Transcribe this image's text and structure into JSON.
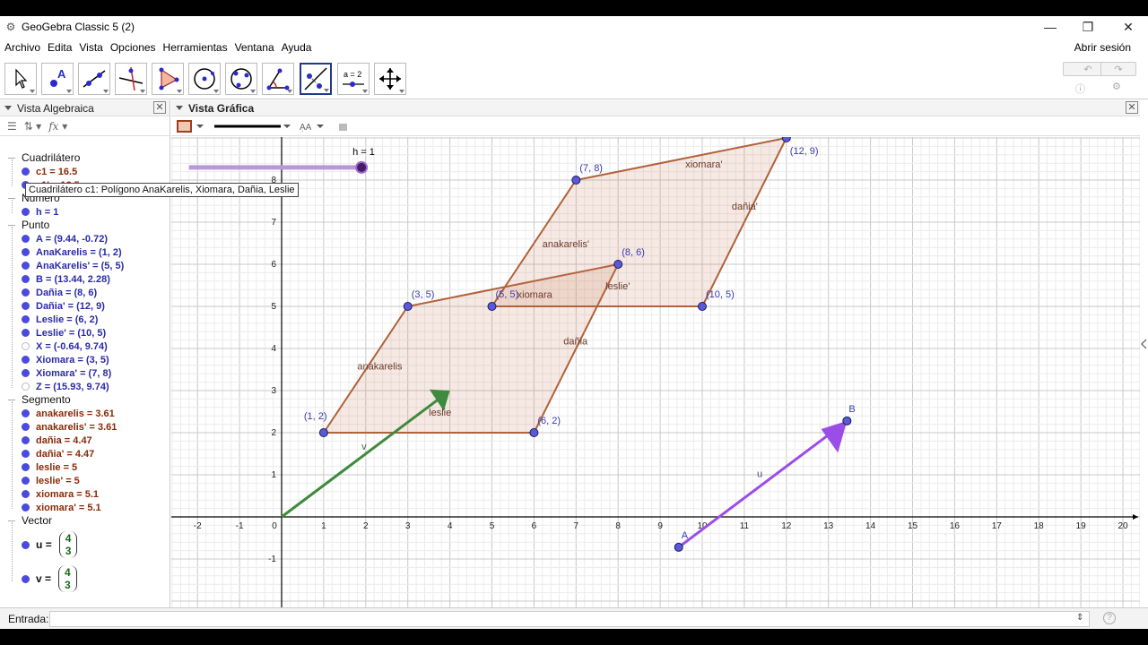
{
  "window": {
    "title": "GeoGebra Classic 5 (2)",
    "minimize": "—",
    "maximize": "❐",
    "close": "✕"
  },
  "menu": {
    "items": [
      "Archivo",
      "Edita",
      "Vista",
      "Opciones",
      "Herramientas",
      "Ventana",
      "Ayuda"
    ],
    "signin": "Abrir sesión"
  },
  "toolbar": {
    "tools": [
      "move",
      "point",
      "line",
      "perpendicular",
      "polygon",
      "circle",
      "conic",
      "angle",
      "reflect",
      "slider",
      "move-graphics"
    ],
    "selected": "reflect",
    "slider_label": "a = 2"
  },
  "algebra": {
    "title": "Vista Algebraica",
    "groups": {
      "quad": "Cuadrilátero",
      "number": "Número",
      "point": "Punto",
      "segment": "Segmento",
      "vector": "Vector"
    },
    "quad_items": [
      "c1 = 16.5",
      "c1' = 16.5"
    ],
    "number_items": [
      "h = 1"
    ],
    "point_items": [
      {
        "text": "A = (9.44, -0.72)",
        "on": true
      },
      {
        "text": "AnaKarelis = (1, 2)",
        "on": true
      },
      {
        "text": "AnaKarelis' = (5, 5)",
        "on": true
      },
      {
        "text": "B = (13.44, 2.28)",
        "on": true
      },
      {
        "text": "Dañia = (8, 6)",
        "on": true
      },
      {
        "text": "Dañia' = (12, 9)",
        "on": true
      },
      {
        "text": "Leslie = (6, 2)",
        "on": true
      },
      {
        "text": "Leslie' = (10, 5)",
        "on": true
      },
      {
        "text": "X = (-0.64, 9.74)",
        "on": false
      },
      {
        "text": "Xiomara = (3, 5)",
        "on": true
      },
      {
        "text": "Xiomara' = (7, 8)",
        "on": true
      },
      {
        "text": "Z = (15.93, 9.74)",
        "on": false
      }
    ],
    "segment_items": [
      "anakarelis = 3.61",
      "anakarelis' = 3.61",
      "dañia = 4.47",
      "dañia' = 4.47",
      "leslie = 5",
      "leslie' = 5",
      "xiomara = 5.1",
      "xiomara' = 5.1"
    ],
    "vectors": [
      {
        "name": "u",
        "a": "4",
        "b": "3"
      },
      {
        "name": "v",
        "a": "4",
        "b": "3"
      }
    ],
    "eq": "="
  },
  "tooltip": "Cuadrilátero c1: Polígono AnaKarelis, Xiomara, Dañia, Leslie",
  "graphics": {
    "title": "Vista Gráfica",
    "slider": {
      "label": "h = 1",
      "value": 1
    },
    "xticks": [
      "-2",
      "-1",
      "0",
      "1",
      "2",
      "3",
      "4",
      "5",
      "6",
      "7",
      "8",
      "9",
      "10",
      "11",
      "12",
      "13",
      "14",
      "15",
      "16",
      "17",
      "18",
      "19",
      "20"
    ],
    "yticks": [
      "-1",
      "1",
      "2",
      "3",
      "4",
      "5",
      "6",
      "7",
      "8"
    ],
    "points": [
      {
        "x": 1,
        "y": 2,
        "label": "(1, 2)"
      },
      {
        "x": 3,
        "y": 5,
        "label": "(3, 5)"
      },
      {
        "x": 8,
        "y": 6,
        "label": "(8, 6)"
      },
      {
        "x": 6,
        "y": 2,
        "label": "(6, 2)"
      },
      {
        "x": 5,
        "y": 5,
        "label": "(5, 5)"
      },
      {
        "x": 7,
        "y": 8,
        "label": "(7, 8)"
      },
      {
        "x": 12,
        "y": 9,
        "label": "(12, 9)"
      },
      {
        "x": 10,
        "y": 5,
        "label": "(10, 5)"
      },
      {
        "x": 9.44,
        "y": -0.72,
        "label": "A"
      },
      {
        "x": 13.44,
        "y": 2.28,
        "label": "B"
      }
    ],
    "segment_labels": [
      {
        "text": "anakarelis",
        "x": 1.8,
        "y": 3.5
      },
      {
        "text": "xiomara",
        "x": 5.6,
        "y": 5.2
      },
      {
        "text": "dañia",
        "x": 6.7,
        "y": 4.1
      },
      {
        "text": "leslie",
        "x": 3.5,
        "y": 2.4
      },
      {
        "text": "anakarelis'",
        "x": 6.2,
        "y": 6.4
      },
      {
        "text": "xiomara'",
        "x": 9.6,
        "y": 8.3
      },
      {
        "text": "dañia'",
        "x": 10.7,
        "y": 7.3
      },
      {
        "text": "leslie'",
        "x": 7.7,
        "y": 5.4
      },
      {
        "text": "v",
        "x": 1.9,
        "y": 1.6
      },
      {
        "text": "u",
        "x": 11.3,
        "y": 0.95
      }
    ]
  },
  "input": {
    "label": "Entrada:",
    "help": "?"
  }
}
